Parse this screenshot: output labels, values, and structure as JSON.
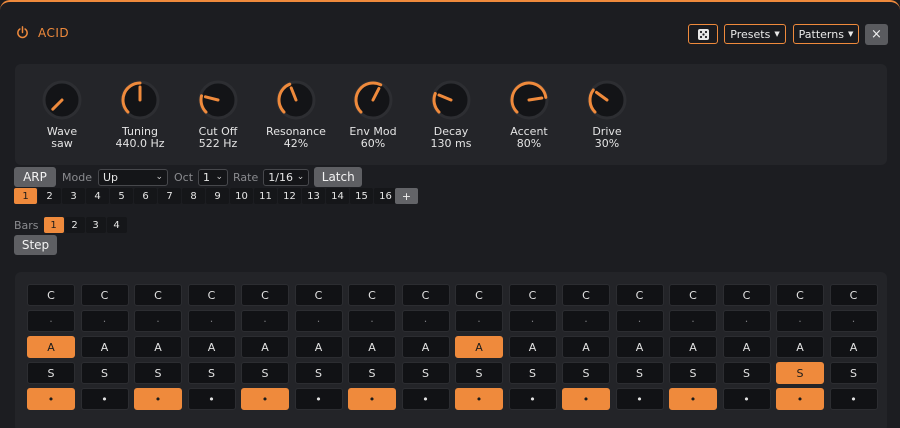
{
  "app": {
    "title": "ACID",
    "power_icon": "power-icon",
    "accent": "#ef8a3c"
  },
  "header": {
    "dice_icon": "dice-icon",
    "presets_label": "Presets",
    "patterns_label": "Patterns",
    "close_label": "×"
  },
  "knobs": [
    {
      "label": "Wave",
      "value": "saw",
      "level": 0.0
    },
    {
      "label": "Tuning",
      "value": "440.0 Hz",
      "level": 0.5
    },
    {
      "label": "Cut Off",
      "value": "522 Hz",
      "level": 0.22
    },
    {
      "label": "Resonance",
      "value": "42%",
      "level": 0.42
    },
    {
      "label": "Env Mod",
      "value": "60%",
      "level": 0.6
    },
    {
      "label": "Decay",
      "value": "130 ms",
      "level": 0.25
    },
    {
      "label": "Accent",
      "value": "80%",
      "level": 0.8
    },
    {
      "label": "Drive",
      "value": "30%",
      "level": 0.3
    }
  ],
  "arp": {
    "button_label": "ARP",
    "mode_label": "Mode",
    "mode_value": "Up",
    "oct_label": "Oct",
    "oct_value": "1",
    "rate_label": "Rate",
    "rate_value": "1/16",
    "latch_label": "Latch"
  },
  "pattern_steps": [
    "1",
    "2",
    "3",
    "4",
    "5",
    "6",
    "7",
    "8",
    "9",
    "10",
    "11",
    "12",
    "13",
    "14",
    "15",
    "16"
  ],
  "pattern_selected": 0,
  "add_label": "+",
  "bars": {
    "label": "Bars",
    "options": [
      "1",
      "2",
      "3",
      "4"
    ],
    "selected": 0
  },
  "step_label": "Step",
  "grid": {
    "rows": [
      {
        "kind": "note",
        "cells": [
          "C",
          "C",
          "C",
          "C",
          "C",
          "C",
          "C",
          "C",
          "C",
          "C",
          "C",
          "C",
          "C",
          "C",
          "C",
          "C"
        ],
        "on": []
      },
      {
        "kind": "octave",
        "cells": [
          "·",
          "·",
          "·",
          "·",
          "·",
          "·",
          "·",
          "·",
          "·",
          "·",
          "·",
          "·",
          "·",
          "·",
          "·",
          "·"
        ],
        "on": []
      },
      {
        "kind": "accent",
        "cells": [
          "A",
          "A",
          "A",
          "A",
          "A",
          "A",
          "A",
          "A",
          "A",
          "A",
          "A",
          "A",
          "A",
          "A",
          "A",
          "A"
        ],
        "on": [
          0,
          8
        ]
      },
      {
        "kind": "slide",
        "cells": [
          "S",
          "S",
          "S",
          "S",
          "S",
          "S",
          "S",
          "S",
          "S",
          "S",
          "S",
          "S",
          "S",
          "S",
          "S",
          "S"
        ],
        "on": [
          14
        ]
      },
      {
        "kind": "gate",
        "cells": [
          "•",
          "•",
          "•",
          "•",
          "•",
          "•",
          "•",
          "•",
          "•",
          "•",
          "•",
          "•",
          "•",
          "•",
          "•",
          "•"
        ],
        "on": [
          0,
          2,
          4,
          6,
          8,
          10,
          12,
          14
        ]
      }
    ]
  }
}
